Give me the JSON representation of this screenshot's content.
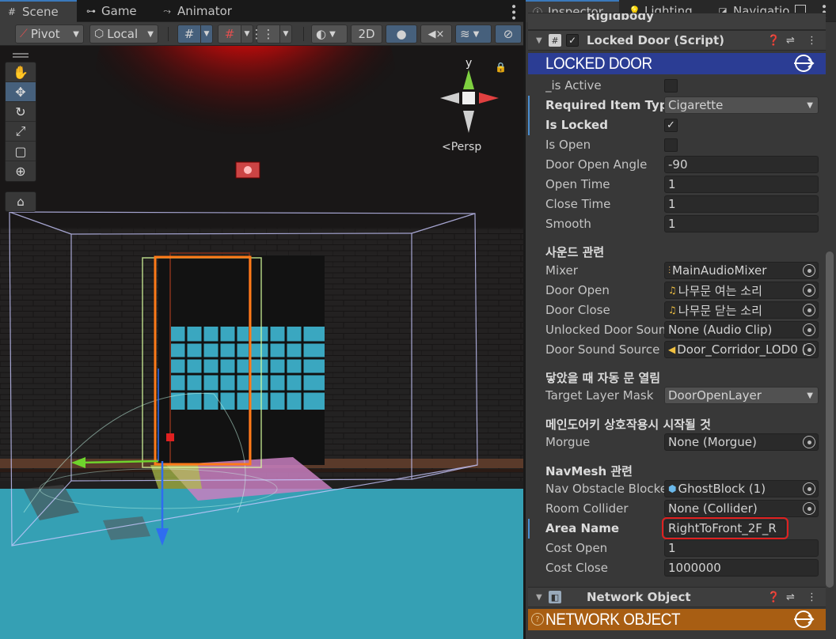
{
  "scene_tabs": [
    {
      "label": "Scene",
      "icon": "hash-icon"
    },
    {
      "label": "Game",
      "icon": "gamepad-icon"
    },
    {
      "label": "Animator",
      "icon": "animator-icon"
    }
  ],
  "toolbar": {
    "pivot": "Pivot",
    "local": "Local",
    "mode2d": "2D"
  },
  "viewport": {
    "axis_y": "y",
    "persp": "<Persp"
  },
  "inspector_tabs": [
    {
      "label": "Inspector",
      "icon": "info-icon"
    },
    {
      "label": "Lighting",
      "icon": "bulb-icon"
    },
    {
      "label": "Navigatio",
      "icon": "nav-icon"
    }
  ],
  "components": {
    "rigidbody": "Rigidbody",
    "locked_door": "Locked Door (Script)",
    "locked_door_banner": "LOCKED DOOR",
    "network": "Network Object",
    "network_banner": "NETWORK OBJECT"
  },
  "fields": {
    "is_active": {
      "label": "_is Active",
      "checked": false
    },
    "required_item": {
      "label": "Required Item Type",
      "value": "Cigarette"
    },
    "is_locked": {
      "label": "Is Locked",
      "checked": true
    },
    "is_open": {
      "label": "Is Open",
      "checked": false
    },
    "door_open_angle": {
      "label": "Door Open Angle",
      "value": "-90"
    },
    "open_time": {
      "label": "Open Time",
      "value": "1"
    },
    "close_time": {
      "label": "Close Time",
      "value": "1"
    },
    "smooth": {
      "label": "Smooth",
      "value": "1"
    },
    "sound_header": "사운드 관련",
    "mixer": {
      "label": "Mixer",
      "value": "MainAudioMixer"
    },
    "door_open": {
      "label": "Door Open",
      "value": "나무문 여는 소리"
    },
    "door_close": {
      "label": "Door Close",
      "value": "나무문 닫는 소리"
    },
    "unlocked_sound": {
      "label": "Unlocked Door Soun",
      "value": "None (Audio Clip)"
    },
    "door_sound_source": {
      "label": "Door Sound Source",
      "value": "Door_Corridor_LOD0 ("
    },
    "auto_header": "닿았을 때 자동 문 열림",
    "target_layer": {
      "label": "Target Layer Mask",
      "value": "DoorOpenLayer"
    },
    "main_header": "메인도어키 상호작용시 시작될 것",
    "morgue": {
      "label": "Morgue",
      "value": "None (Morgue)"
    },
    "navmesh_header": "NavMesh 관련",
    "nav_obstacle": {
      "label": "Nav Obstacle Blocke",
      "value": "GhostBlock (1)"
    },
    "room_collider": {
      "label": "Room Collider",
      "value": "None (Collider)"
    },
    "area_name": {
      "label": "Area Name",
      "value": "RightToFront_2F_R"
    },
    "cost_open": {
      "label": "Cost Open",
      "value": "1"
    },
    "cost_close": {
      "label": "Cost Close",
      "value": "1000000"
    }
  },
  "colors": {
    "locked_banner": "#2b3d94",
    "network_banner": "#a85e13",
    "accent": "#3a79bb",
    "highlight": "#e02020"
  }
}
